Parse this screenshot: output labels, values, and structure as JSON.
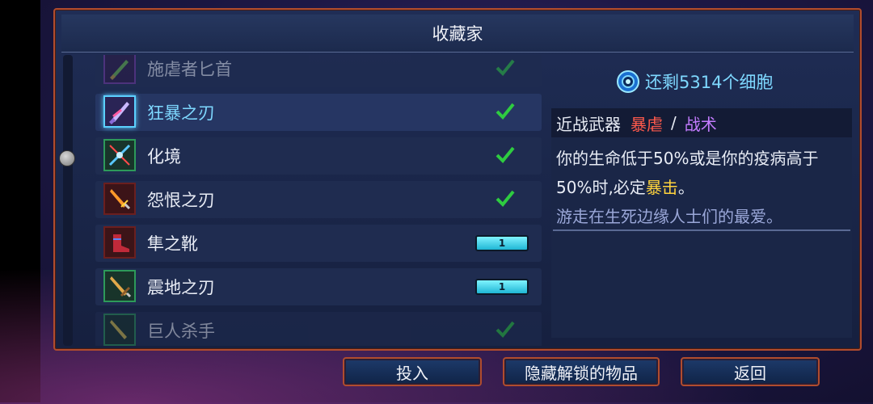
{
  "title": "收藏家",
  "items": [
    {
      "name": "施虐者匕首",
      "status": "unlocked",
      "icon": "dagger-icon"
    },
    {
      "name": "狂暴之刃",
      "status": "unlocked",
      "icon": "blade-icon"
    },
    {
      "name": "化境",
      "status": "unlocked",
      "icon": "spear-icon"
    },
    {
      "name": "怨恨之刃",
      "status": "unlocked",
      "icon": "sword-icon"
    },
    {
      "name": "隼之靴",
      "status": "invest",
      "cost": "1",
      "icon": "boots-icon"
    },
    {
      "name": "震地之刃",
      "status": "invest",
      "cost": "1",
      "icon": "greatsword-icon"
    },
    {
      "name": "巨人杀手",
      "status": "unlocked",
      "icon": "giant-killer-icon"
    }
  ],
  "cells_remaining": "还剩5314个细胞",
  "detail": {
    "category": "近战武器",
    "tag1": "暴虐",
    "separator": "/",
    "tag2": "战术",
    "desc_part1": "你的生命低于50%或是你的疫病高于50%时,必定",
    "desc_crit": "暴击",
    "desc_part2": "。",
    "flavor": "游走在生死边缘人士们的最爱。"
  },
  "buttons": {
    "invest": "投入",
    "hide_unlocked": "隐藏解锁的物品",
    "back": "返回"
  },
  "colors": {
    "frame": "#b04c2e",
    "check": "#2ecc40",
    "cells": "#7ed8ff",
    "crit": "#ffd33d"
  }
}
